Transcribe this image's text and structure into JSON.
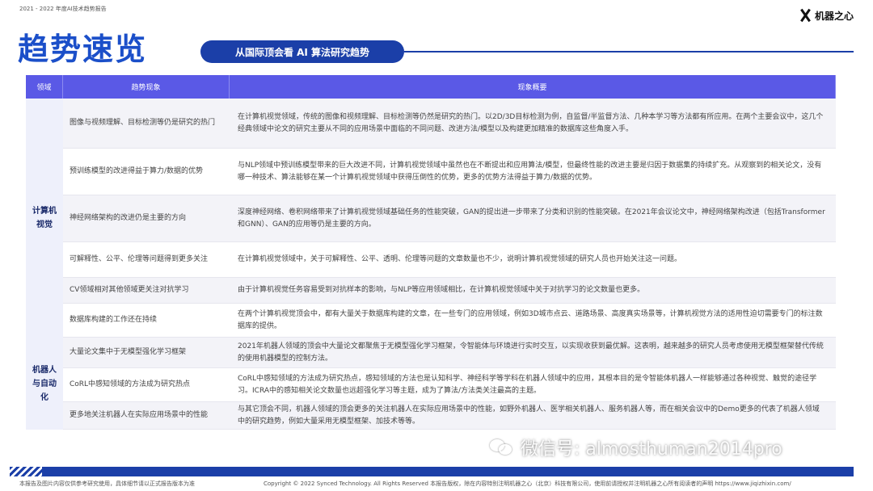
{
  "header": {
    "report_tag": "2021 - 2022 年度AI技术趋势报告",
    "brand": "机器之心",
    "title": "趋势速览",
    "subtitle": "从国际顶会看 AI 算法研究趋势"
  },
  "table": {
    "columns": [
      "领域",
      "趋势现象",
      "现象概要"
    ],
    "groups": [
      {
        "label": "计算机视觉",
        "rows": [
          {
            "trend": "图像与视频理解、目标检测等仍是研究的热门",
            "desc": "在计算机视觉领域，传统的图像和视频理解、目标检测等仍然是研究的热门。以2D/3D目标检测为例，自监督/半监督方法、几种本学习等方法都有所应用。在两个主要会议中，这几个经典领域中论文的研究主要从不同的应用场景中面临的不同问题、改进方法/模型以及构建更加精准的数据库这些角度入手。"
          },
          {
            "trend": "预训练模型的改进得益于算力/数据的优势",
            "desc": "与NLP领域中预训练模型带来的巨大改进不同，计算机视觉领域中虽然也在不断提出和应用算法/模型，但最终性能的改进主要是归因于数据集的持续扩充。从观察到的相关论文，没有哪一种技术、算法能够在某一个计算机视觉领域中获得压倒性的优势，更多的优势方法得益于算力/数据的优势。"
          },
          {
            "trend": "神经网络架构的改进仍是主要的方向",
            "desc": "深度神经网络、卷积网络带来了计算机视觉领域基础任务的性能突破，GAN的提出进一步带来了分类和识别的性能突破。在2021年会议论文中，神经网络架构改进（包括Transformer和GNN）、GAN的应用等仍是主要的方向。"
          },
          {
            "trend": "可解释性、公平、伦理等问题得到更多关注",
            "desc": "在计算机视觉领域中，关于可解释性、公平、透明、伦理等问题的文章数量也不少，说明计算机视觉领域的研究人员也开始关注这一问题。"
          },
          {
            "trend": "CV领域相对其他领域更关注对抗学习",
            "desc": "由于计算机视觉任务容易受到对抗样本的影响，与NLP等应用领域相比，在计算机视觉领域中关于对抗学习的论文数量也更多。"
          },
          {
            "trend": "数据库构建的工作还在持续",
            "desc": "在两个计算机视觉顶会中，都有大量关于数据库构建的文章，在一些专门的应用领域，例如3D城市点云、道路场景、高度真实场景等，计算机视觉方法的适用性迫切需要专门的标注数据库的提供。"
          }
        ]
      },
      {
        "label": "机器人与自动化",
        "rows": [
          {
            "trend": "大量论文集中于无模型强化学习框架",
            "desc": "2021年机器人领域的顶会中大量论文都聚焦于无模型强化学习框架，令智能体与环境进行实时交互，以实现收获到最优解。这表明，越来越多的研究人员考虑使用无模型框架替代传统的使用机器模型的控制方法。"
          },
          {
            "trend": "CoRL中感知领域的方法成为研究热点",
            "desc": "CoRL中感知领域的方法成为研究热点，感知领域的方法也是认知科学、神经科学等学科在机器人领域中的应用，其根本目的是令智能体机器人一样能够通过各种视觉、触觉的途径学习。ICRA中的感知相关论文数量也远超强化学习等主题，成为了算法/方法类关注最高的主题。"
          },
          {
            "trend": "更多地关注机器人在实际应用场景中的性能",
            "desc": "与其它顶会不同，机器人领域的顶会更多的关注机器人在实际应用场景中的性能，如野外机器人、医学相关机器人、服务机器人等，而在相关会议中的Demo更多的代表了机器人领域中的研究趋势，例如大量采用无模型框架、加技术等等。"
          }
        ]
      }
    ]
  },
  "watermark": "微信号: almosthuman2014pro",
  "footer": {
    "left": "本报告及图片内容仅供参考研究使用，具体细节请以正式报告版本为准",
    "right": "Copyright © 2022 Synced Technology. All Rights Reserved  本报告版权，除在内容特别注明机器之心（北京）科技有限公司，使用前请授权并注明机器之心所有阅读者的声明  https://www.jiqizhixin.com/"
  }
}
